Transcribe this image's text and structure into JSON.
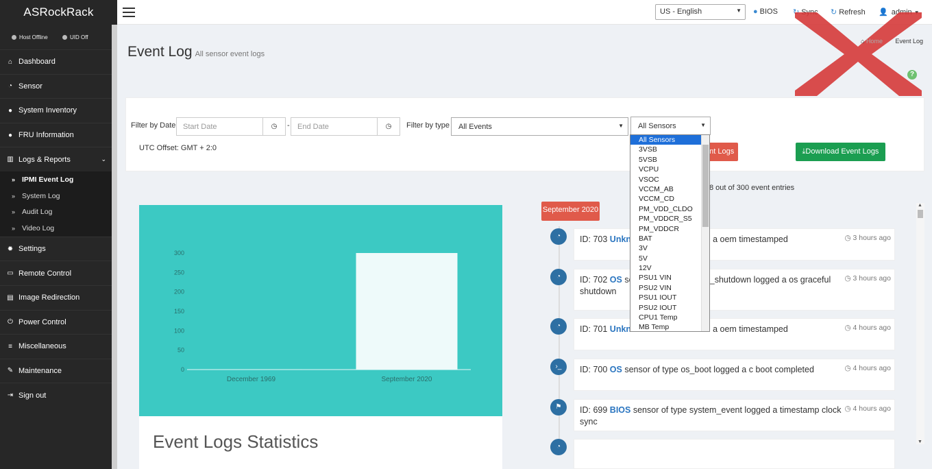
{
  "sidebar": {
    "brand": "ASRockRack",
    "status_host": "Host Offline",
    "status_uid": "UID Off",
    "items": [
      {
        "label": "Dashboard",
        "icon": "home-icon"
      },
      {
        "label": "Sensor",
        "icon": "dashboard-icon"
      },
      {
        "label": "System Inventory",
        "icon": "info-icon"
      },
      {
        "label": "FRU Information",
        "icon": "info-icon"
      },
      {
        "label": "Logs & Reports",
        "icon": "bar-chart-icon"
      }
    ],
    "sub_items": [
      "IPMI Event Log",
      "System Log",
      "Audit Log",
      "Video Log"
    ],
    "items_after": [
      {
        "label": "Settings",
        "icon": "gear-icon"
      },
      {
        "label": "Remote Control",
        "icon": "monitor-icon"
      },
      {
        "label": "Image Redirection",
        "icon": "disk-icon"
      },
      {
        "label": "Power Control",
        "icon": "power-icon"
      },
      {
        "label": "Miscellaneous",
        "icon": "list-icon"
      },
      {
        "label": "Maintenance",
        "icon": "wrench-icon"
      },
      {
        "label": "Sign out",
        "icon": "sign-out-icon"
      }
    ]
  },
  "topbar": {
    "language": "US - English",
    "bios": "BIOS",
    "sync": "Sync",
    "refresh": "Refresh",
    "user": "admin"
  },
  "page": {
    "title": "Event Log",
    "subtitle": "All sensor event logs",
    "breadcrumb_home": "Home",
    "breadcrumb_current": "Event Log"
  },
  "filters": {
    "date_label": "Filter by Date",
    "start_placeholder": "Start Date",
    "end_placeholder": "End Date",
    "dash": "-",
    "type_label": "Filter by type",
    "type_value": "All Events",
    "sensor_value": "All Sensors",
    "utc_offset": "UTC Offset: GMT + 2:0",
    "clear_label": "ent Logs",
    "download_label": "Download Event Logs"
  },
  "sensor_options": [
    "All Sensors",
    "3VSB",
    "5VSB",
    "VCPU",
    "VSOC",
    "VCCM_AB",
    "VCCM_CD",
    "PM_VDD_CLDO",
    "PM_VDDCR_S5",
    "PM_VDDCR",
    "BAT",
    "3V",
    "5V",
    "12V",
    "PSU1 VIN",
    "PSU2 VIN",
    "PSU1 IOUT",
    "PSU2 IOUT",
    "CPU1 Temp",
    "MB Temp"
  ],
  "entries_text": "8 out of 300 event entries",
  "chart_data": {
    "type": "bar",
    "categories": [
      "December 1969",
      "September 2020"
    ],
    "values": [
      0,
      300
    ],
    "yticks": [
      0,
      50,
      100,
      150,
      200,
      250,
      300
    ],
    "ylim": [
      0,
      300
    ],
    "title": "",
    "xlabel": "",
    "ylabel": "",
    "bar_color": "#eefafa",
    "background": "#3cc9c3"
  },
  "stats_title": "Event Logs Statistics",
  "timeline": {
    "month": "September 2020",
    "events": [
      {
        "id": "ID: 703",
        "sensor": "Unkno",
        "rest": "ed a oem timestamped",
        "time": "3 hours ago",
        "icon": "dashboard-icon"
      },
      {
        "id": "ID: 702",
        "sensor": "OS",
        "rest": "sens",
        "rest2": "_shutdown logged a os graceful shutdown",
        "time": "3 hours ago",
        "icon": "dashboard-icon"
      },
      {
        "id": "ID: 701",
        "sensor": "Unkno",
        "rest": "ed a oem timestamped",
        "time": "4 hours ago",
        "icon": "dashboard-icon"
      },
      {
        "id": "ID: 700",
        "sensor": "OS",
        "rest": "sensor of type os_boot logged a c boot completed",
        "time": "4 hours ago",
        "icon": "terminal-icon"
      },
      {
        "id": "ID: 699",
        "sensor": "BIOS",
        "rest": "sensor of type system_event logged a timestamp clock sync",
        "time": "4 hours ago",
        "icon": "flag-icon"
      }
    ]
  }
}
